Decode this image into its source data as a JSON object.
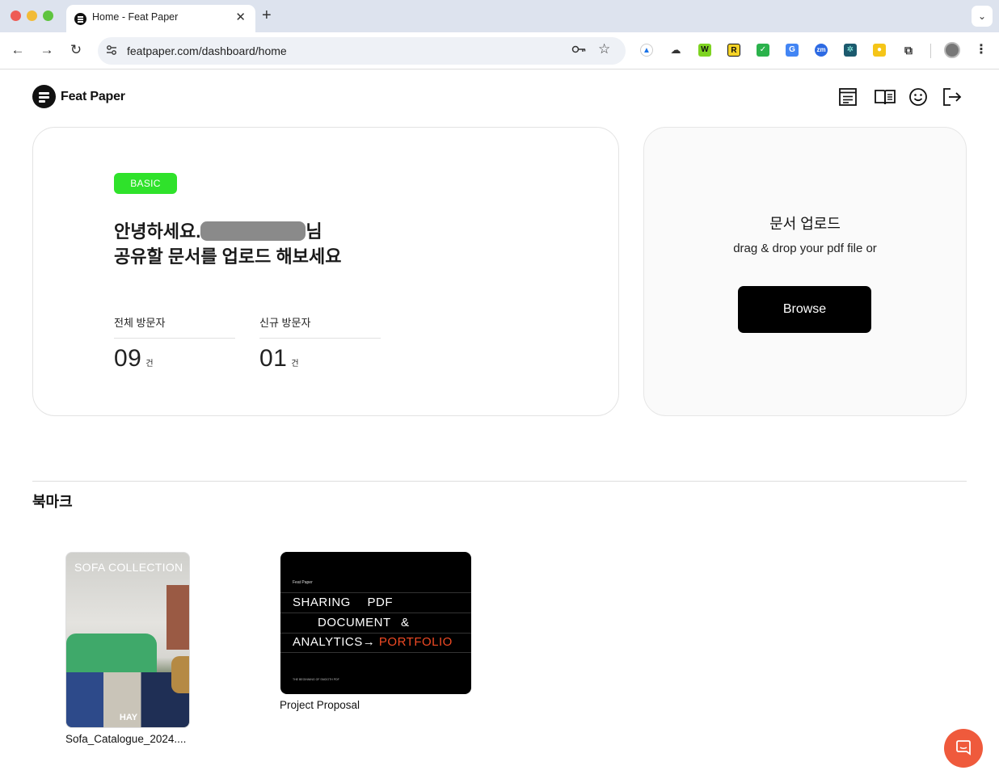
{
  "browser": {
    "tab_title": "Home - Feat Paper",
    "url": "featpaper.com/dashboard/home"
  },
  "header": {
    "logo_text": "Feat Paper"
  },
  "welcome": {
    "plan_badge": "BASIC",
    "greeting_prefix": "안녕하세요.",
    "greeting_suffix": "님",
    "greeting_line2": "공유할 문서를 업로드 해보세요",
    "stats": [
      {
        "label": "전체 방문자",
        "value": "09",
        "unit": "건"
      },
      {
        "label": "신규 방문자",
        "value": "01",
        "unit": "건"
      }
    ]
  },
  "upload": {
    "title": "문서 업로드",
    "subtitle": "drag & drop your pdf file or",
    "browse_label": "Browse"
  },
  "bookmarks": {
    "title": "북마크",
    "items": [
      {
        "name": "Sofa_Catalogue_2024....",
        "thumb_title": "SOFA COLLECTION",
        "thumb_brand": "HAY"
      },
      {
        "name": "Project Proposal",
        "thumb_brand": "Feat Paper",
        "thumb_lines": [
          "SHARING PDF",
          "DOCUMENT &",
          "ANALYTICS→"
        ],
        "thumb_highlight": "PORTFOLIO",
        "thumb_footer": "THE BEGINNING OF SMOOTH PDF"
      }
    ]
  },
  "colors": {
    "badge": "#2fe22b",
    "browse_bg": "#000000",
    "fab": "#ef5a3c",
    "portfolio_text": "#f04a24"
  },
  "icons": {
    "header": [
      "document-list-icon",
      "open-book-icon",
      "smiley-icon",
      "logout-icon"
    ],
    "fab": "chat-icon"
  }
}
